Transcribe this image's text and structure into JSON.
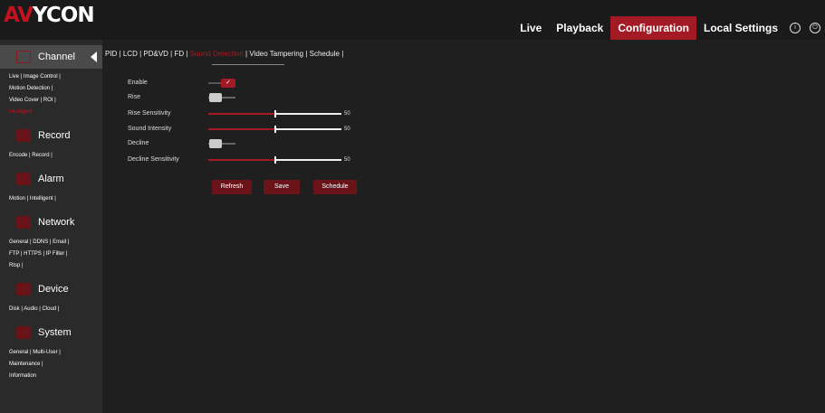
{
  "logo": {
    "accent": "AV",
    "rest": "YCON"
  },
  "topnav": {
    "items": [
      "Live",
      "Playback",
      "Configuration",
      "Local Settings"
    ],
    "active_color": "#a31a24",
    "icons": [
      "info-icon",
      "power-icon"
    ]
  },
  "sidebar": {
    "sections": [
      {
        "title": "Channel",
        "links": [
          "Live | Image Control |",
          "Motion Detection |",
          "Video Cover | ROI |"
        ],
        "highlight": "Intelligent"
      },
      {
        "title": "Record",
        "links": [
          "Encode | Record |"
        ]
      },
      {
        "title": "Alarm",
        "links": [
          "Motion | Intelligent |"
        ]
      },
      {
        "title": "Network",
        "links": [
          "General | DDNS | Email |",
          "FTP | HTTPS | IP Filter |",
          "Rtsp |"
        ]
      },
      {
        "title": "Device",
        "links": [
          "Disk | Audio | Cloud |"
        ]
      },
      {
        "title": "System",
        "links": [
          "General | Multi-User |",
          "Maintenance |",
          "Information"
        ]
      }
    ]
  },
  "tabs": {
    "before": "PID  |  LCD  |  PD&VD  |  FD  |  ",
    "active": "Sound Detection",
    "after": "  |  Video Tampering  |  Schedule  |"
  },
  "form": {
    "enable_label": "Enable",
    "enable_state": "on",
    "rise_label": "Rise",
    "rise_state": "off",
    "rise_sensitivity_label": "Rise Sensitivity",
    "rise_sensitivity_value": 50,
    "sound_intensity_label": "Sound Intensity",
    "sound_intensity_value": 50,
    "decline_label": "Decline",
    "decline_state": "off",
    "decline_sensitivity_label": "Decline Sensitivity",
    "decline_sensitivity_value": 50,
    "slider_max": 100,
    "check_glyph": "✓"
  },
  "buttons": {
    "refresh": "Refresh",
    "save": "Save",
    "schedule": "Schedule"
  }
}
